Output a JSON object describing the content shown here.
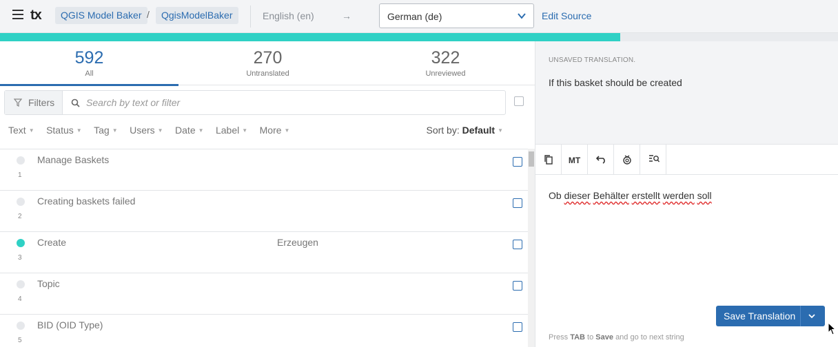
{
  "header": {
    "breadcrumbs": [
      "QGIS Model Baker",
      "QgisModelBaker"
    ],
    "separator": "/",
    "source_language": "English (en)",
    "arrow": "→",
    "target_language": "German (de)",
    "edit_source": "Edit Source",
    "logo": "tx"
  },
  "progress": {
    "reviewed_fraction": 0.74
  },
  "tabs": [
    {
      "count": "592",
      "label": "All"
    },
    {
      "count": "270",
      "label": "Untranslated"
    },
    {
      "count": "322",
      "label": "Unreviewed"
    }
  ],
  "filters": {
    "button_label": "Filters",
    "search_placeholder": "Search by text or filter",
    "facets": [
      "Text",
      "Status",
      "Tag",
      "Users",
      "Date",
      "Label",
      "More"
    ],
    "sort_prefix": "Sort by:",
    "sort_value": "Default"
  },
  "strings": [
    {
      "index": "1",
      "source": "Manage Baskets",
      "translation": "",
      "status": "untranslated"
    },
    {
      "index": "2",
      "source": "Creating baskets failed",
      "translation": "",
      "status": "untranslated"
    },
    {
      "index": "3",
      "source": "Create",
      "translation": "Erzeugen",
      "status": "translated"
    },
    {
      "index": "4",
      "source": "Topic",
      "translation": "",
      "status": "untranslated"
    },
    {
      "index": "5",
      "source": "BID (OID Type)",
      "translation": "",
      "status": "untranslated"
    }
  ],
  "editor": {
    "unsaved_label": "UNSAVED TRANSLATION.",
    "source_text": "If this basket should be created",
    "translation_words": [
      "Ob",
      "dieser",
      "Behälter",
      "erstellt",
      "werden",
      "soll"
    ],
    "misspelled": [
      false,
      true,
      true,
      true,
      true,
      true
    ],
    "mt_label": "MT",
    "save_label": "Save Translation",
    "hint_press": "Press",
    "hint_key": "TAB",
    "hint_to": "to",
    "hint_save": "Save",
    "hint_rest": "and go to next string"
  }
}
